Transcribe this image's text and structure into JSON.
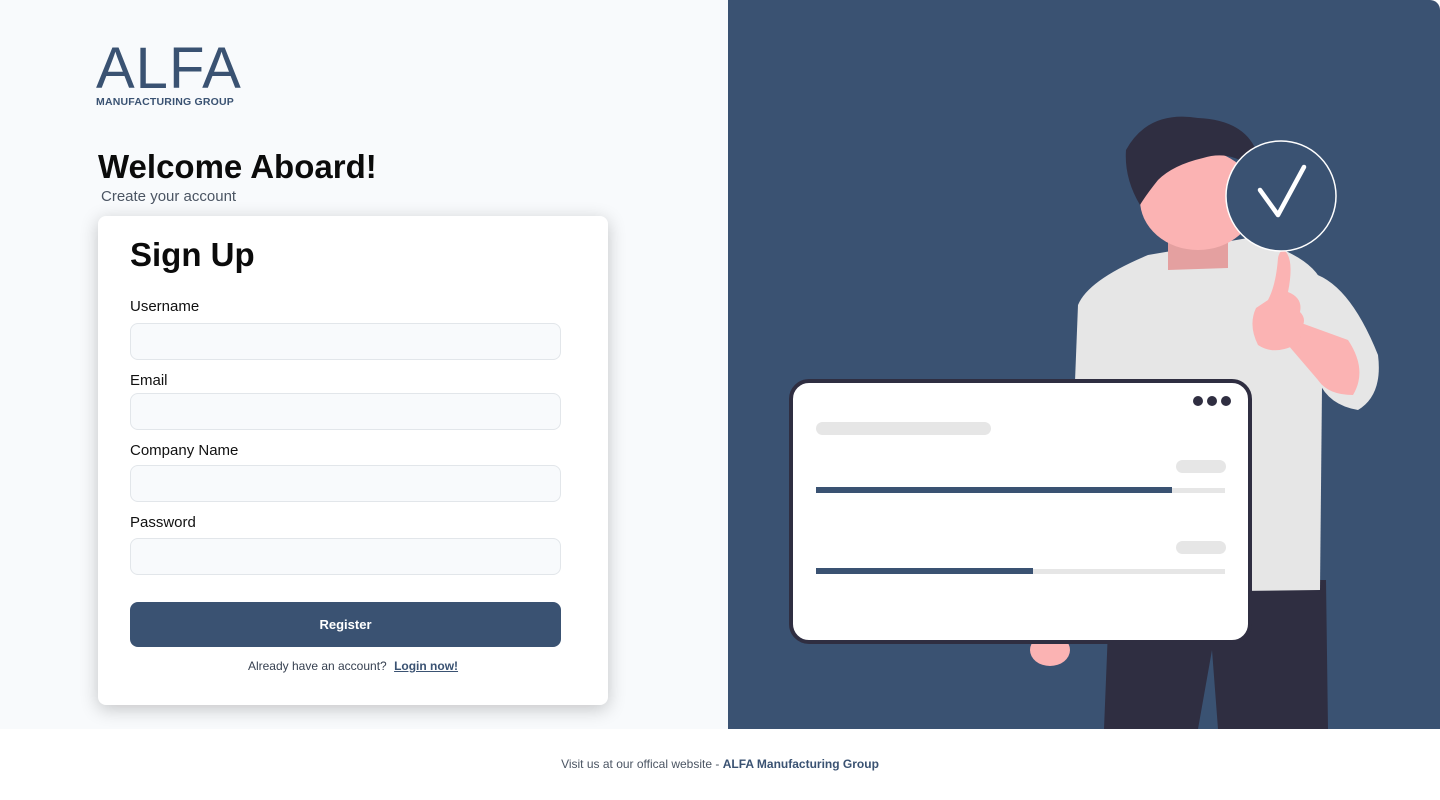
{
  "brand": {
    "logo_word": "ALFA",
    "logo_sub": "MANUFACTURING GROUP"
  },
  "hero": {
    "title": "Welcome Aboard!",
    "subtitle": "Create your account"
  },
  "form": {
    "title": "Sign Up",
    "fields": {
      "username": {
        "label": "Username",
        "value": "",
        "placeholder": ""
      },
      "email": {
        "label": "Email",
        "value": "",
        "placeholder": ""
      },
      "company": {
        "label": "Company Name",
        "value": "",
        "placeholder": ""
      },
      "password": {
        "label": "Password",
        "value": "",
        "placeholder": ""
      }
    },
    "submit_label": "Register",
    "login_prompt": "Already have an account?",
    "login_link": "Login now!"
  },
  "footer": {
    "text": "Visit us at our offical website -",
    "link": "ALFA Manufacturing Group"
  },
  "illustration": {
    "check_icon": "check-icon",
    "progress_bars": [
      0.87,
      0.53
    ]
  },
  "colors": {
    "primary": "#3a5272",
    "left_bg": "#f8fafc",
    "skin": "#fbb3b3",
    "hair": "#2f2e41",
    "shirt": "#e6e6e6"
  }
}
